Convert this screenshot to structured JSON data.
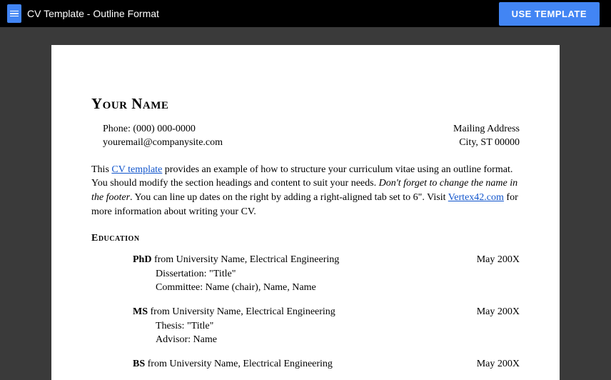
{
  "header": {
    "title": "CV Template - Outline Format",
    "button": "USE TEMPLATE"
  },
  "doc": {
    "name": "Your Name",
    "contact": {
      "phone_label": "Phone: ",
      "phone": "(000) 000-0000",
      "email": "youremail@companysite.com",
      "mailing_label": "Mailing Address",
      "city": "City, ST 00000"
    },
    "intro": {
      "p1a": "This ",
      "link1": "CV template",
      "p1b": " provides an example of how to structure your curriculum vitae using an outline format. You should modify the section headings and content to suit your needs. ",
      "em": "Don't forget to change the name in the footer",
      "p1c": ". You can line up dates on the right by adding a right-aligned tab set to 6\". Visit ",
      "link2": "Vertex42.com",
      "p1d": " for more information about writing your CV."
    },
    "education": {
      "heading": "Education",
      "entries": [
        {
          "degree": "PhD",
          "from": " from University Name, Electrical Engineering",
          "date": "May 200X",
          "line2_label": "Dissertation: ",
          "line2_value": "\"Title\"",
          "line3_label": "Committee: ",
          "line3_value": "Name (chair), Name, Name"
        },
        {
          "degree": "MS",
          "from": " from University Name, Electrical Engineering",
          "date": "May 200X",
          "line2_label": "Thesis: ",
          "line2_value": "\"Title\"",
          "line3_label": "Advisor: ",
          "line3_value": "Name"
        },
        {
          "degree": "BS",
          "from": " from University Name, Electrical Engineering",
          "date": "May 200X",
          "line2_label": "",
          "line2_value": "",
          "line3_label": "",
          "line3_value": ""
        }
      ]
    }
  }
}
